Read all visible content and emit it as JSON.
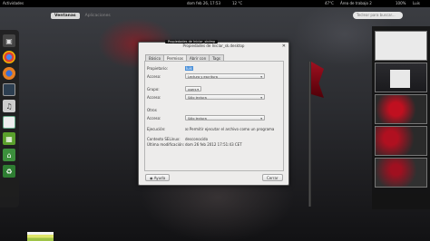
{
  "topbar": {
    "activities": "Actividades",
    "clock": "dom feb 26, 17:53",
    "temp": "12 °C",
    "cpu_temp": "47°C",
    "workspace": "Área de trabajo 2",
    "battery": "100%",
    "user": "Luis"
  },
  "overview": {
    "tabs": [
      {
        "label": "Ventanas",
        "active": true
      },
      {
        "label": "Aplicaciones",
        "active": false
      }
    ],
    "search_placeholder": "Teclear para buscar..."
  },
  "dash": {
    "icons": [
      "terminal-icon",
      "chrome-icon",
      "firefox-icon",
      "monitor-icon",
      "music-icon",
      "document-icon",
      "calc-icon",
      "app-grid-icon",
      "recycle-icon"
    ]
  },
  "window": {
    "tooltip": "Propiedades de Iniciar_skdmp",
    "title": "Propiedades de Iniciar_sk.desktop",
    "tabs": [
      "Básico",
      "Permisos",
      "Abrir con",
      "Tags"
    ],
    "active_tab": "Permisos",
    "fields": {
      "owner_label": "Propietario:",
      "owner_value": "luis",
      "access_label": "Acceso:",
      "owner_access": "Lectura y escritura",
      "group_label": "Grupo:",
      "group_value": "users",
      "group_access": "Sólo lectura",
      "others_label": "Otros",
      "others_access": "Sólo lectura",
      "exec_label": "Ejecución:",
      "exec_text": "Permitir ejecutar el archivo como un programa",
      "selinux_label": "Contexto SELinux:",
      "selinux_value": "desconocido",
      "modified_label": "Última modificación:",
      "modified_value": "dom 26 feb 2012 17:51:43 CET"
    },
    "help_button": "Ayuda",
    "close_button": "Cerrar"
  }
}
